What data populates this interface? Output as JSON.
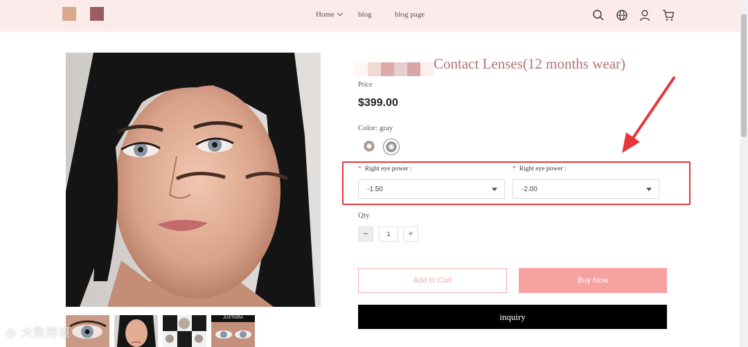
{
  "header": {
    "nav": [
      {
        "label": "Home"
      },
      {
        "label": "blog"
      },
      {
        "label": "blog page"
      }
    ],
    "icons": [
      "search-icon",
      "globe-icon",
      "user-icon",
      "cart-icon"
    ],
    "background": "#fcebeb"
  },
  "product": {
    "title": "Contact Lenses(12 months wear)",
    "price_label": "Price",
    "price": "$399.00",
    "color_label": "Color: gray",
    "swatches": [
      "brown",
      "gray"
    ],
    "options": [
      {
        "label": "Right eye power :",
        "value": "-1.50"
      },
      {
        "label": "Right eye power :",
        "value": "-2.00"
      }
    ],
    "qty_label": "Qty",
    "qty_minus": "−",
    "qty_value": "1",
    "qty_plus": "+",
    "add_to_cart": "Add to Cart",
    "buy_now": "Buy Now",
    "inquiry": "inquiry"
  },
  "gallery": {
    "thumb4_text": "JUSTKIRA"
  },
  "watermark": "大数跨境",
  "colors": {
    "accent_pink": "#f7a1a1",
    "title_color": "#b37276",
    "highlight_red": "#e8353a"
  }
}
